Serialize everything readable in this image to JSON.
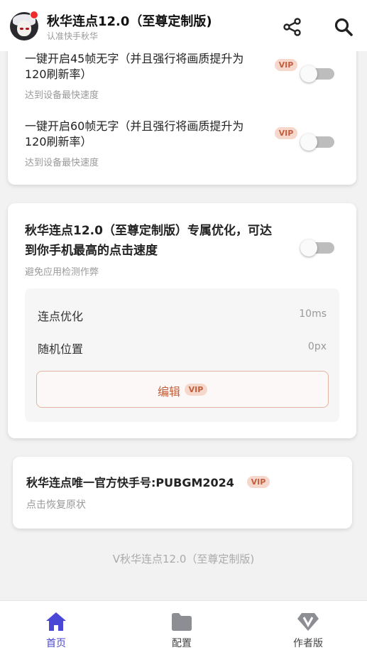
{
  "header": {
    "title": "秋华连点12.0（至尊定制版)",
    "subtitle": "认准快手秋华",
    "icons": [
      "share-icon",
      "search-icon"
    ]
  },
  "card1": {
    "items": [
      {
        "title_line1": "一键开启45帧无字（并且强行将画质提升为",
        "title_line2": "120刷新率）",
        "subtitle": "达到设备最快速度",
        "badge": "VIP",
        "toggle_on": false
      },
      {
        "title_line1": "一键开启60帧无字（并且强行将画质提升为",
        "title_line2": "120刷新率）",
        "subtitle": "达到设备最快速度",
        "badge": "VIP",
        "toggle_on": false
      }
    ]
  },
  "card2": {
    "title_line1": "秋华连点12.0（至尊定制版）专属优化，可达",
    "title_line2": "到你手机最高的点击速度",
    "subtitle": "避免应用检测作弊",
    "toggle_on": false,
    "settings": [
      {
        "label": "连点优化",
        "value": "10ms"
      },
      {
        "label": "随机位置",
        "value": "0px"
      }
    ],
    "edit_label": "编辑",
    "edit_badge": "VIP"
  },
  "card3": {
    "title": "秋华连点唯一官方快手号:PUBGM2024",
    "badge": "VIP",
    "subtitle": "点击恢复原状"
  },
  "footer": {
    "version": "V秋华连点12.0（至尊定制版)"
  },
  "bottom_nav": {
    "items": [
      {
        "label": "首页",
        "icon": "home-icon",
        "active": true
      },
      {
        "label": "配置",
        "icon": "folder-icon",
        "active": false
      },
      {
        "label": "作者版",
        "icon": "vip-diamond-icon",
        "active": false
      }
    ]
  },
  "colors": {
    "accent": "#4a47d6",
    "vip_bg": "#f6d7cc",
    "vip_text": "#c0603e",
    "toggle_off": "#bdbdbd"
  }
}
